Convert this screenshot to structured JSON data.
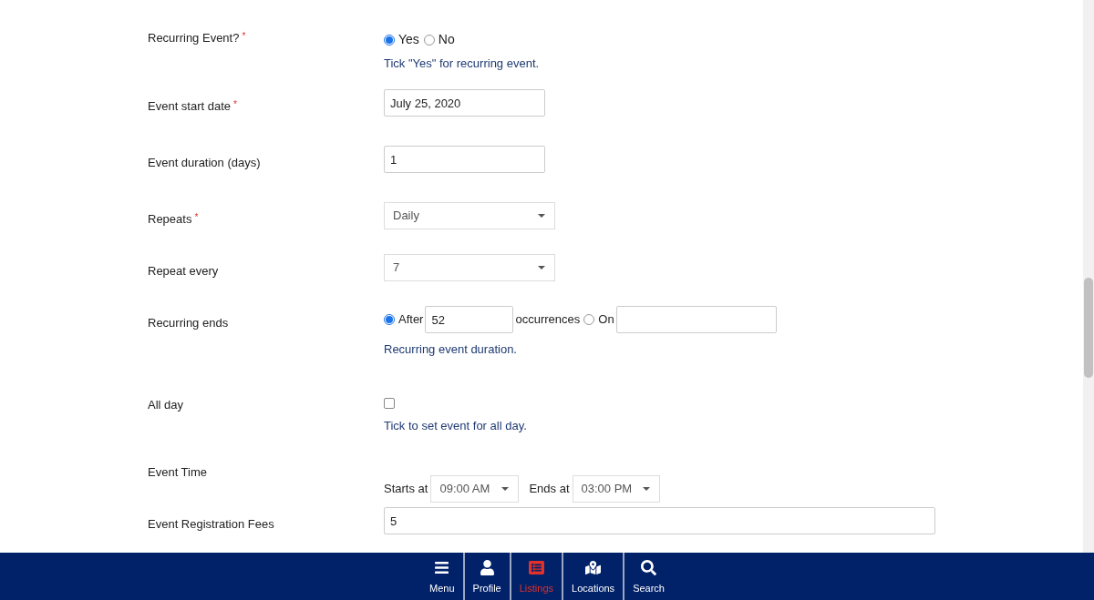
{
  "fields": [
    {
      "kind": "radio_group",
      "label": "Recurring Event?",
      "required_mark": "*",
      "options": [
        {
          "label": "Yes",
          "selected": true
        },
        {
          "label": "No",
          "selected": false
        }
      ],
      "help": "Tick \"Yes\" for recurring event."
    },
    {
      "kind": "text",
      "label": "Event start date",
      "required_mark": "*",
      "value": "July 25, 2020"
    },
    {
      "kind": "text",
      "label": "Event duration (days)",
      "value": "1"
    },
    {
      "kind": "select",
      "label": "Repeats",
      "required_mark": "*",
      "value": "Daily"
    },
    {
      "kind": "select",
      "label": "Repeat every",
      "value": "7"
    },
    {
      "kind": "recurring_ends",
      "label": "Recurring ends",
      "after": {
        "label": "After",
        "selected": true,
        "value": "52",
        "suffix": "occurrences"
      },
      "on": {
        "label": "On",
        "selected": false
      },
      "help": "Recurring event duration."
    },
    {
      "kind": "checkbox",
      "label": "All day",
      "checked": false,
      "help": "Tick to set event for all day."
    },
    {
      "kind": "time_range",
      "label": "Event Time",
      "start": {
        "label": "Starts at",
        "value": "09:00 AM"
      },
      "end": {
        "label": "Ends at",
        "value": "03:00 PM"
      }
    },
    {
      "kind": "text_wide",
      "label": "Event Registration Fees",
      "value": "5"
    }
  ],
  "nav": [
    {
      "label": "Menu",
      "selected": false
    },
    {
      "label": "Profile",
      "selected": false
    },
    {
      "label": "Listings",
      "selected": true
    },
    {
      "label": "Locations",
      "selected": false
    },
    {
      "label": "Search",
      "selected": false
    }
  ]
}
